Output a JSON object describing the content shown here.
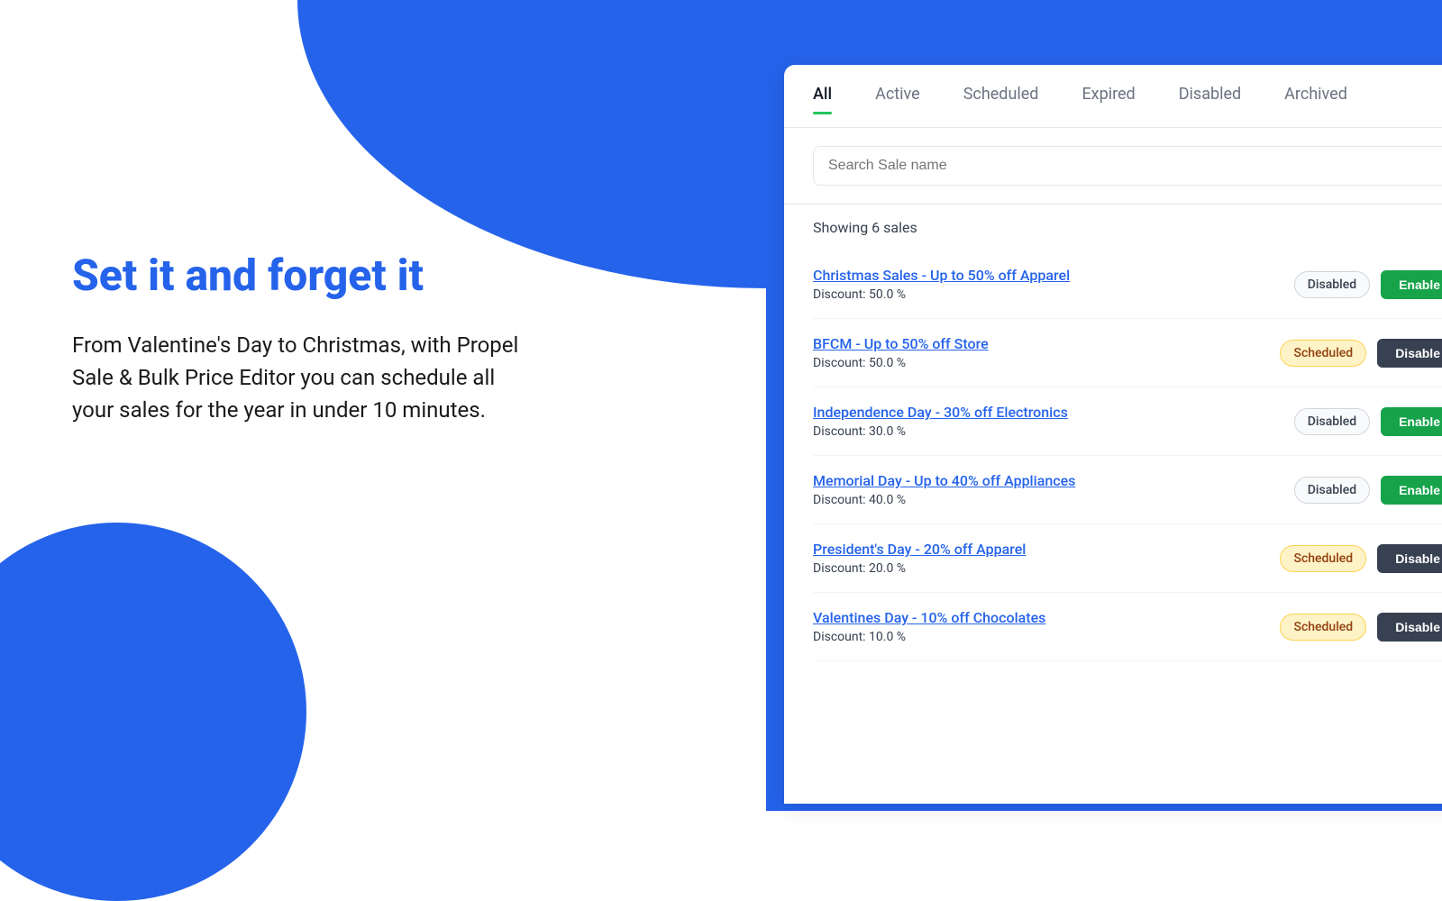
{
  "left": {
    "heading": "Set it and forget it",
    "subtext": "From Valentine's Day to Christmas, with Propel Sale & Bulk Price Editor you can schedule all your sales for the year in under 10 minutes."
  },
  "tabs": [
    {
      "id": "all",
      "label": "All",
      "active": true
    },
    {
      "id": "active",
      "label": "Active",
      "active": false
    },
    {
      "id": "scheduled",
      "label": "Scheduled",
      "active": false
    },
    {
      "id": "expired",
      "label": "Expired",
      "active": false
    },
    {
      "id": "disabled",
      "label": "Disabled",
      "active": false
    },
    {
      "id": "archived",
      "label": "Archived",
      "active": false
    }
  ],
  "search": {
    "placeholder": "Search Sale name"
  },
  "count": "Showing 6 sales",
  "sales": [
    {
      "name": "Christmas Sales - Up to 50% off Apparel",
      "discount": "Discount: 50.0 %",
      "status": "Disabled",
      "statusType": "disabled",
      "actionLabel": "Enable",
      "actionType": "enable"
    },
    {
      "name": "BFCM - Up to 50% off Store",
      "discount": "Discount: 50.0 %",
      "status": "Scheduled",
      "statusType": "scheduled",
      "actionLabel": "Disable",
      "actionType": "disable"
    },
    {
      "name": "Independence Day - 30% off Electronics",
      "discount": "Discount: 30.0 %",
      "status": "Disabled",
      "statusType": "disabled",
      "actionLabel": "Enable",
      "actionType": "enable"
    },
    {
      "name": "Memorial Day - Up to 40% off Appliances",
      "discount": "Discount: 40.0 %",
      "status": "Disabled",
      "statusType": "disabled",
      "actionLabel": "Enable",
      "actionType": "enable"
    },
    {
      "name": "President's Day - 20% off Apparel",
      "discount": "Discount: 20.0 %",
      "status": "Scheduled",
      "statusType": "scheduled",
      "actionLabel": "Disable",
      "actionType": "disable"
    },
    {
      "name": "Valentines Day - 10% off Chocolates",
      "discount": "Discount: 10.0 %",
      "status": "Scheduled",
      "statusType": "scheduled",
      "actionLabel": "Disable",
      "actionType": "disable"
    }
  ]
}
